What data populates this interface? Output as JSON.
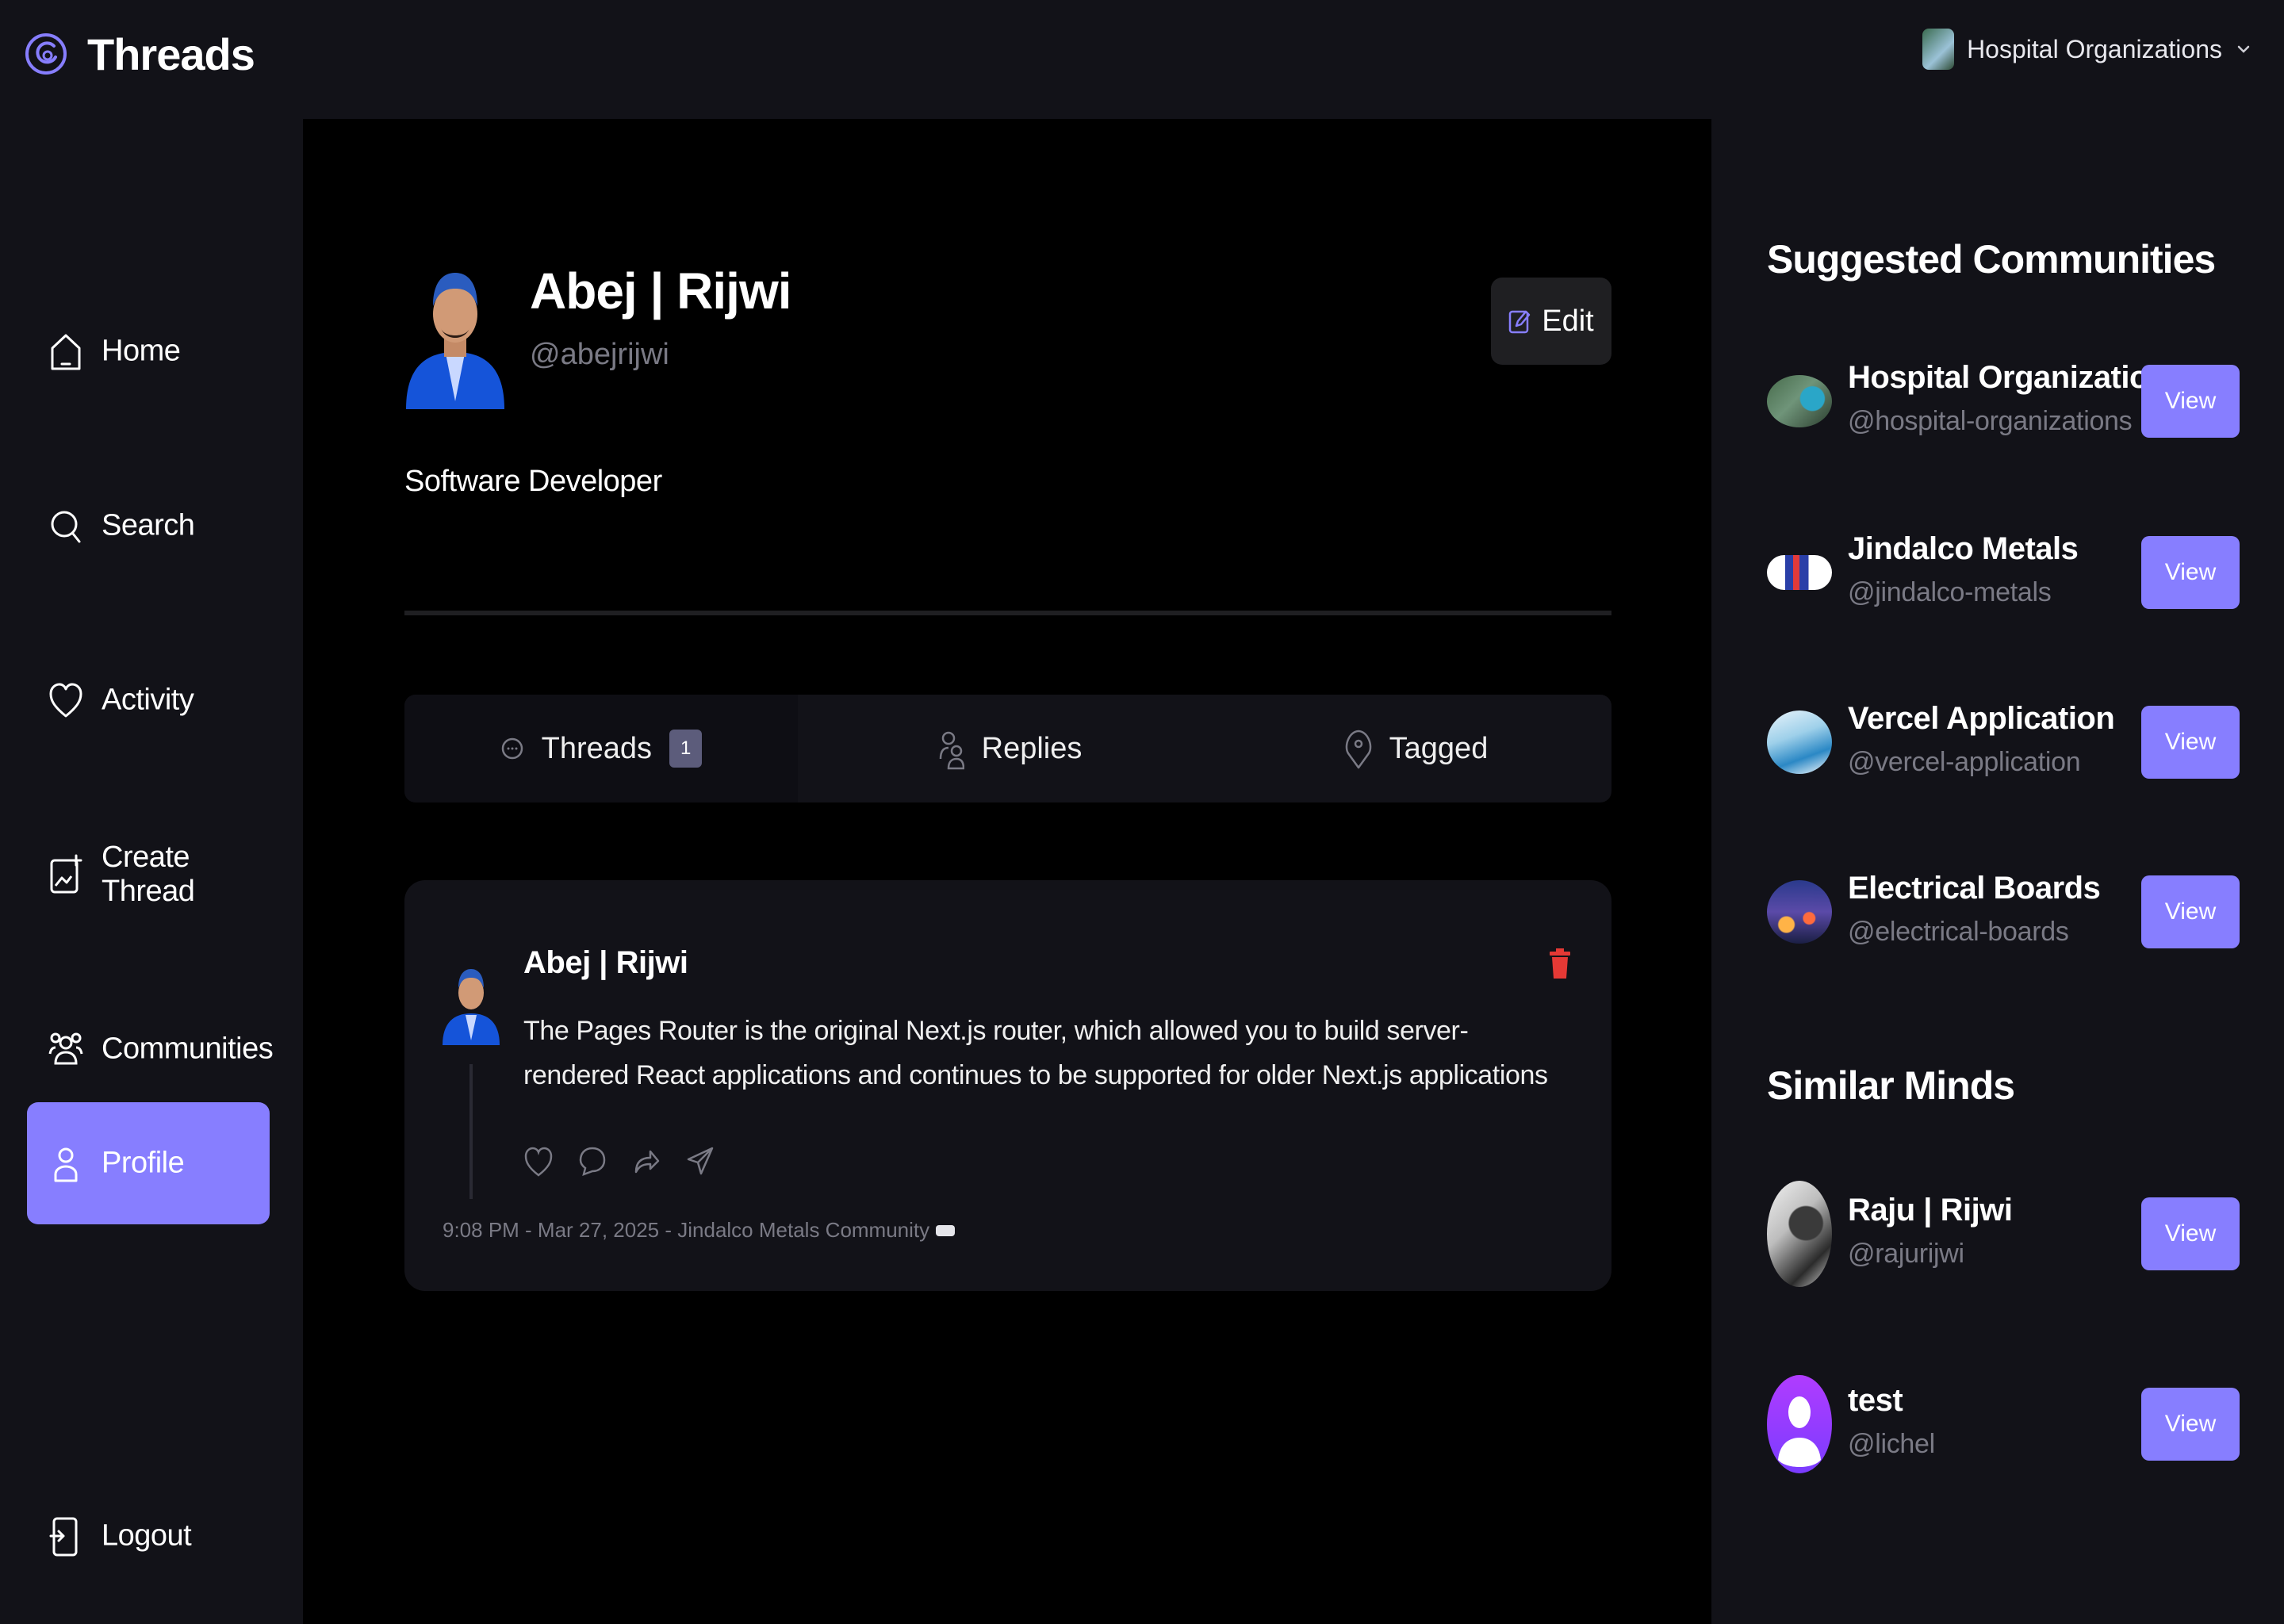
{
  "app": {
    "title": "Threads"
  },
  "org_switcher": {
    "name": "Hospital Organizations"
  },
  "sidebar": {
    "items": [
      {
        "label": "Home",
        "icon": "home-icon"
      },
      {
        "label": "Search",
        "icon": "search-icon"
      },
      {
        "label": "Activity",
        "icon": "heart-icon"
      },
      {
        "label": "Create Thread",
        "icon": "create-thread-icon"
      },
      {
        "label": "Communities",
        "icon": "communities-icon"
      },
      {
        "label": "Profile",
        "icon": "profile-icon",
        "active": true
      }
    ],
    "logout": {
      "label": "Logout",
      "icon": "logout-icon"
    }
  },
  "profile": {
    "name": "Abej | Rijwi",
    "handle": "@abejrijwi",
    "bio": "Software Developer",
    "edit_label": "Edit"
  },
  "tabs": [
    {
      "label": "Threads",
      "count": "1",
      "icon": "chat-icon",
      "active": true
    },
    {
      "label": "Replies",
      "icon": "members-icon"
    },
    {
      "label": "Tagged",
      "icon": "tag-icon"
    }
  ],
  "thread": {
    "author": "Abej | Rijwi",
    "text": "The Pages Router is the original Next.js router, which allowed you to build server-rendered React applications and continues to be supported for older Next.js applications",
    "meta": "9:08 PM - Mar 27, 2025 - Jindalco Metals Community"
  },
  "suggested_communities": {
    "heading": "Suggested Communities",
    "items": [
      {
        "name": "Hospital Organizations",
        "handle": "@hospital-organizations",
        "button": "View"
      },
      {
        "name": "Jindalco Metals",
        "handle": "@jindalco-metals",
        "button": "View"
      },
      {
        "name": "Vercel Application",
        "handle": "@vercel-application",
        "button": "View"
      },
      {
        "name": "Electrical Boards",
        "handle": "@electrical-boards",
        "button": "View"
      }
    ]
  },
  "similar_minds": {
    "heading": "Similar Minds",
    "items": [
      {
        "name": "Raju | Rijwi",
        "handle": "@rajurijwi",
        "button": "View"
      },
      {
        "name": "test",
        "handle": "@lichel",
        "button": "View"
      }
    ]
  },
  "colors": {
    "accent": "#877eff",
    "panel": "#121218",
    "main_bg": "#000000",
    "muted_text": "#7a7a85",
    "delete": "#e53935"
  }
}
